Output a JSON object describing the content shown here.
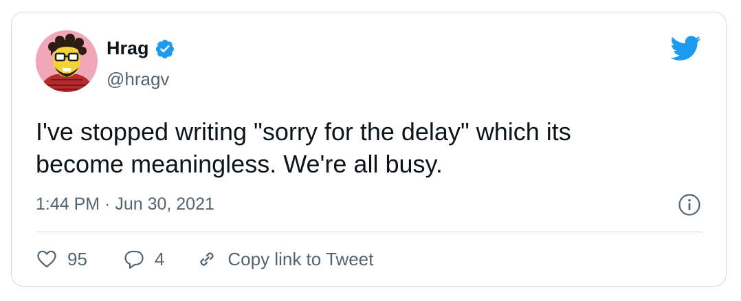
{
  "author": {
    "name": "Hrag",
    "handle": "@hragv"
  },
  "tweet": {
    "text": "I've stopped writing \"sorry for the delay\" which its become meaningless. We're all busy.",
    "timestamp": "1:44 PM · Jun 30, 2021"
  },
  "actions": {
    "likes": "95",
    "replies": "4",
    "copy_link_label": "Copy link to Tweet"
  },
  "icons": {
    "verified": "verified-badge-icon",
    "brand": "twitter-bird-icon",
    "info": "info-icon",
    "like": "heart-icon",
    "reply": "reply-bubble-icon",
    "link": "link-icon"
  },
  "colors": {
    "brand": "#1d9bf0",
    "text": "#0f1419",
    "muted": "#536471",
    "border": "#cfd9de"
  }
}
